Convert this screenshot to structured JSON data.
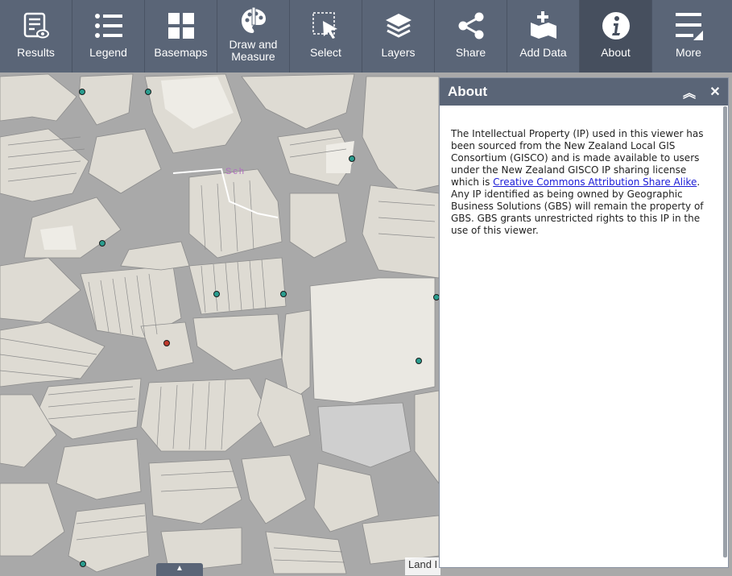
{
  "toolbar": {
    "items": [
      {
        "label": "Results",
        "icon": "results-icon"
      },
      {
        "label": "Legend",
        "icon": "legend-icon"
      },
      {
        "label": "Basemaps",
        "icon": "basemaps-icon"
      },
      {
        "label_line1": "Draw and",
        "label_line2": "Measure",
        "icon": "palette-icon"
      },
      {
        "label": "Select",
        "icon": "select-cursor-icon"
      },
      {
        "label": "Layers",
        "icon": "layers-icon"
      },
      {
        "label": "Share",
        "icon": "share-icon"
      },
      {
        "label": "Add Data",
        "icon": "add-data-icon"
      },
      {
        "label": "About",
        "icon": "info-icon",
        "active": true
      },
      {
        "label": "More",
        "icon": "menu-icon"
      }
    ]
  },
  "map": {
    "label": "Sch",
    "attribution": "Land I",
    "toggle_symbol": "▲"
  },
  "about_panel": {
    "title": "About",
    "collapse_symbol": "︽",
    "close_symbol": "✕",
    "text_before_link": "The Intellectual Property (IP) used in this viewer has been sourced from the New Zealand Local GIS Consortium (GISCO) and is made available to users under the New Zealand GISCO IP sharing license which is ",
    "link_text": "Creative Commons Attribution Share Alike",
    "text_after_link": ". Any IP identified as being owned by Geographic Business Solutions (GBS) will remain the property of GBS. GBS grants unrestricted rights to this IP in the use of this viewer."
  },
  "colors": {
    "toolbar_bg": "#5a6577",
    "active_tool_bg": "#464f5e",
    "road": "#a9a9a9",
    "parcel": "#dedbd3",
    "point_marker": "#2a9d8f",
    "selected_marker": "#c0392b",
    "link": "#1a1ad6"
  }
}
